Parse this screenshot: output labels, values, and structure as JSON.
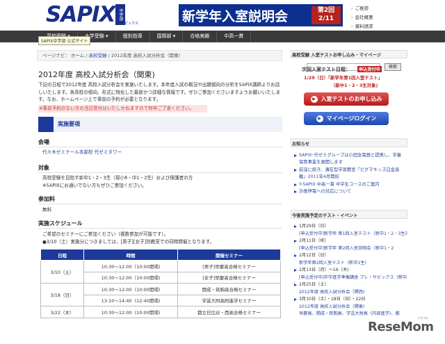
{
  "header": {
    "logo_text": "SAPIX",
    "logo_side": "中学部",
    "logo_small": "サピックス",
    "banner_title": "新学年入室説明会",
    "banner_badge_line1": "第2回",
    "banner_badge_line2": "2/11",
    "util_links": [
      "ご挨拶",
      "会社概要",
      "資料請求"
    ]
  },
  "nav": {
    "items": [
      "高校受験 ▾",
      "大学受験 ▾",
      "個別指導",
      "国際部 ▾",
      "合格実績",
      "中高一貫"
    ],
    "tooltip": "SAPIX中学部 公式サイト",
    "search_button": "検索"
  },
  "breadcrumb": {
    "prefix": "ページナビ：",
    "home": "ホーム",
    "sep": "/",
    "section": "高校受験",
    "current": "2012年度 高校入試分析会（関東)"
  },
  "main": {
    "title": "2012年度 高校入試分析会（関東)",
    "intro": "下記の日程で2012年度 高校入試分析会を実施いたします。本年度入試の概況や出題傾向の分析をSAPIX講師よりお話しいたします。各高校の傾向、形式に特化した最新かつ詳細な情報です。ぜひご参加くださいますようお願いいたします。なお、ホームページ上で事前の予約が必要となります。",
    "notice": "※事前予約のない方の当日受付はいたしかねますので何卒ご了承ください。",
    "section_heading": "実施要項",
    "venue_h": "会場",
    "venue_link": "代々木ゼミナール本部校 代ゼミタワー",
    "target_h": "対象",
    "target_1": "高校受験を目指す新中1・2・3生（現小6・中1・2生）および保護者の方",
    "target_2": "※SAPIXにお通いでない方もぜひご参加ください。",
    "fee_h": "参加料",
    "fee": "無料",
    "schedule_h": "実施スケジュール",
    "schedule_1": "ご希望のセミナーにご参加ください（複数参加が可能です）。",
    "schedule_2": "●3/10（土）実施分につきましては，[男子][女子]別教室での同時開催となります。",
    "table_headers": [
      "日程",
      "時間",
      "開催セミナー"
    ],
    "table_rows": [
      [
        "3/10（土）",
        "10:30〜12:00（10:00開場)",
        "[男子]早慶高合格セミナー"
      ],
      [
        "",
        "10:30〜12:00（10:00開場)",
        "[女子]早慶高合格セミナー"
      ],
      [
        "3/18（日）",
        "10:30〜12:00（10:00開場)",
        "開成・筑駒高合格セミナー"
      ],
      [
        "",
        "13:10〜14:40（12:40開場)",
        "学芸大附高附進学セミナー"
      ],
      [
        "3/22（木）",
        "10:30〜12:00（10:00開場)",
        "都立日比谷・西高合格セミナー"
      ]
    ]
  },
  "sidebar": {
    "apply_heading": "高校受験 入室テストお申し込み・マイページ",
    "test_label": "次回入室テスト日程：",
    "accepting": "申込受付中",
    "test_date": "1/29（日）「新学年第1回入室テスト」",
    "test_grade": "（新中1・2・3生対象)",
    "btn_apply": "入室テストのお申し込み",
    "btn_mypage": "マイページログイン",
    "news_heading": "お知らせ",
    "news": [
      "SAPIX･代ゼミグループは小田急電鉄と提携し、学童保育事業を展開します",
      "荻窪に続き、溝在型学習教室「ピグマキッズ白金高輪」2011年4月開校",
      "Y-SAPIX 中高一貫 中学生コースのご案内",
      "計画停電への対応について"
    ],
    "events_heading": "今後実施予定のテスト・イベント",
    "events": [
      {
        "kind": "dt",
        "text": "1月29日（日）"
      },
      {
        "kind": "ev",
        "text": "[申込受付中]新学年 第1回入室テスト（新中1・2・3生対象)"
      },
      {
        "kind": "dt",
        "text": "2月11日（祝）"
      },
      {
        "kind": "ev",
        "text": "[申込受付中]新学年 第2回入室説明会（新中1・2"
      },
      {
        "kind": "dt",
        "text": "2月12日（日）"
      },
      {
        "kind": "ev",
        "text": "新学年第2回入室テスト（新中1生)"
      },
      {
        "kind": "dt",
        "text": "2月13日（月）〜16（木)"
      },
      {
        "kind": "ev",
        "text": "[申込受付中]中学進学準備講座 プレ・サピックス（新中1生)"
      },
      {
        "kind": "dt",
        "text": "2月25日（土）"
      },
      {
        "kind": "ev",
        "text": "2012年度 高校入試分析会（関西)"
      },
      {
        "kind": "dt",
        "text": "3月10日（土）・18日（日）・22日"
      },
      {
        "kind": "ev",
        "text": "2012年度 高校入試分析会（関東)"
      },
      {
        "kind": "ev",
        "text": "早慶高、開成・筑駒高、学芸大附高（内部進学)、都"
      }
    ]
  },
  "watermark": "ReseMom",
  "watermark_small": "リセマム",
  "colors": {
    "brand": "#1d3a9a",
    "nav": "#3a3a3a",
    "banner_badge": "#b4231e",
    "notice": "#cc3333"
  }
}
